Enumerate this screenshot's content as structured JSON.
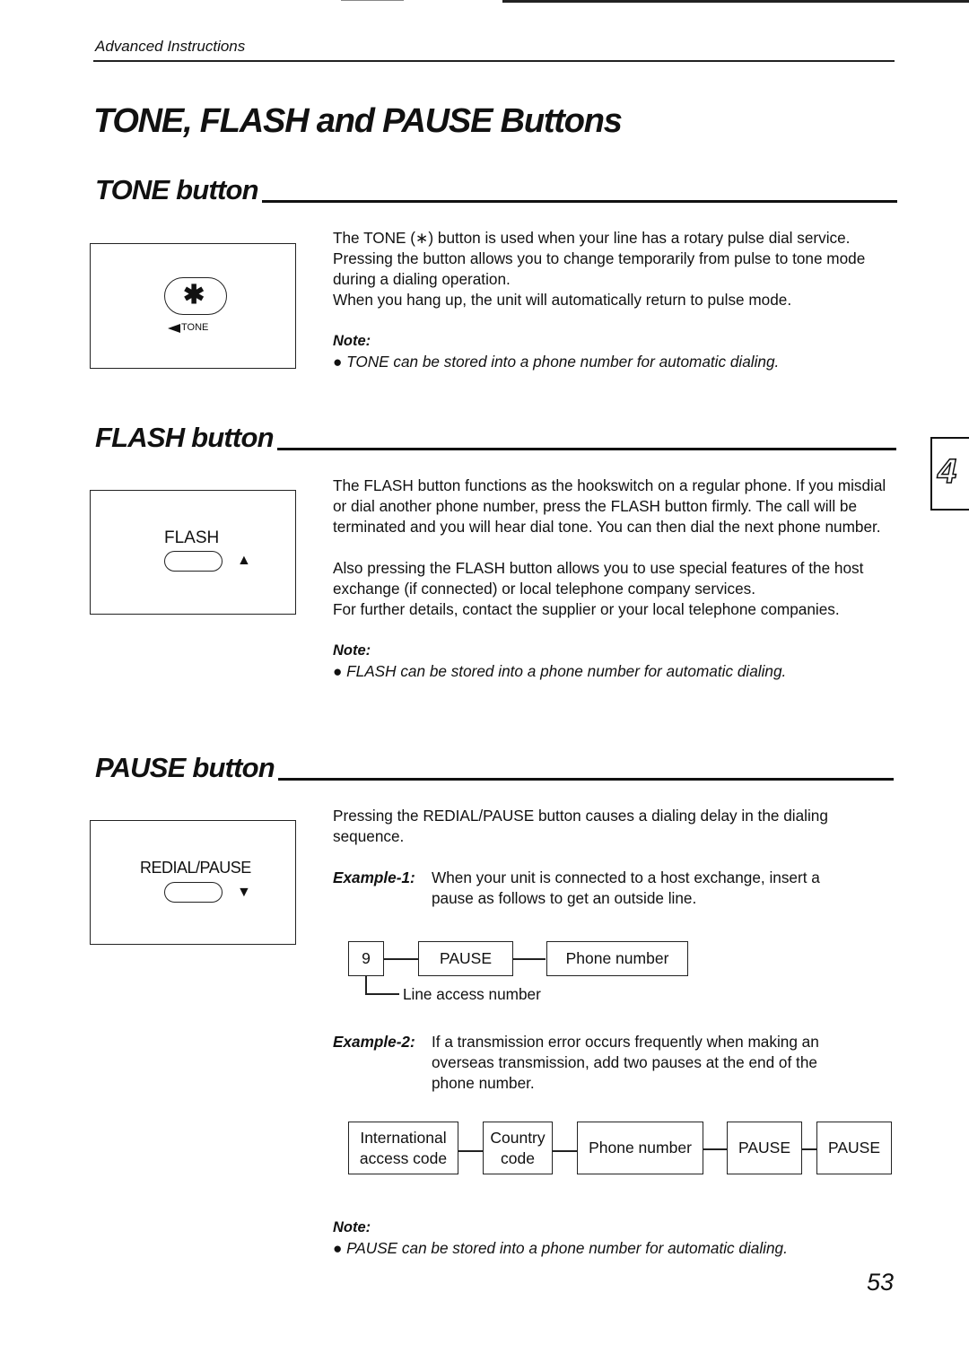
{
  "running_head": "Advanced Instructions",
  "page_title": "TONE, FLASH and PAUSE Buttons",
  "chapter_tab": "4",
  "page_number": "53",
  "sections": {
    "tone": {
      "heading": "TONE button",
      "illustration": {
        "key_symbol": "✱",
        "caption": "TONE"
      },
      "paragraphs": [
        "The TONE (∗) button is used when your line has a rotary pulse dial service. Pressing the button allows you to change temporarily from pulse to tone mode during a dialing operation.",
        "When you hang up, the unit will automatically return to pulse mode."
      ],
      "note_label": "Note:",
      "note": "● TONE can be stored into a phone number for automatic dialing."
    },
    "flash": {
      "heading": "FLASH button",
      "illustration": {
        "key_label": "FLASH",
        "arrow": "▲"
      },
      "paragraphs": [
        "The FLASH button functions as the hookswitch on a regular phone. If you misdial or dial another phone number, press the FLASH button firmly. The call will be terminated and you will hear dial tone. You can then dial the next phone number.",
        "Also pressing the FLASH button allows you to use special features of the host exchange (if connected) or local telephone company services.",
        "For further details, contact the supplier or your local telephone companies."
      ],
      "note_label": "Note:",
      "note": "● FLASH can be stored into a phone number for automatic dialing."
    },
    "pause": {
      "heading": "PAUSE button",
      "illustration": {
        "key_label": "REDIAL/PAUSE",
        "arrow": "▼"
      },
      "paragraphs": [
        "Pressing the REDIAL/PAUSE button causes a dialing delay in the dialing sequence."
      ],
      "example1": {
        "label": "Example-1:",
        "text": "When your unit is connected to a host exchange, insert a pause as follows to get an outside line.",
        "diagram": {
          "boxes": [
            "9",
            "PAUSE",
            "Phone number"
          ],
          "callout": "Line access number"
        }
      },
      "example2": {
        "label": "Example-2:",
        "text": "If a transmission error occurs frequently when making an overseas transmission, add two pauses at the end of the phone number.",
        "diagram": {
          "boxes": [
            {
              "line1": "International",
              "line2": "access code"
            },
            {
              "line1": "Country",
              "line2": "code"
            },
            {
              "line1": "Phone number",
              "line2": ""
            },
            {
              "line1": "PAUSE",
              "line2": ""
            },
            {
              "line1": "PAUSE",
              "line2": ""
            }
          ]
        }
      },
      "note_label": "Note:",
      "note": "● PAUSE can be stored into a phone number for automatic dialing."
    }
  }
}
